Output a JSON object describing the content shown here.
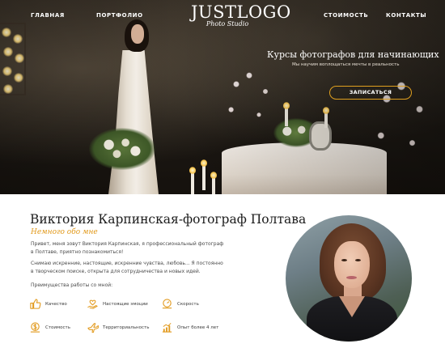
{
  "nav": {
    "home": "ГЛАВНАЯ",
    "portfolio": "ПОРТФОЛИО",
    "price": "СТОИМОСТЬ",
    "contacts": "КОНТАКТЫ"
  },
  "logo": {
    "main": "JUSTLOGO",
    "sub": "Photo Studio"
  },
  "hero": {
    "title": "Курсы фотографов для начинающих",
    "subtitle": "Мы научим воплощаться мечты в реальность",
    "button": "ЗАПИСАТЬСЯ"
  },
  "about": {
    "title": "Виктория Карпинская-фотограф Полтава",
    "script": "Немного обо мне",
    "p1": "Привет, меня зовут Виктория Карпинская, я профессиональный фотограф в Полтаве, приятно познакомиться!",
    "p2": "Снимаю искренние, настоящие, искренние чувства, любовь... Я постоянно в творческом поиске, открыта для сотрудничества и новых идей.",
    "p3": "Преимущества работы со мной:"
  },
  "features": [
    {
      "label": "Качество",
      "icon": "thumbs-up-icon"
    },
    {
      "label": "Настоящие эмоции",
      "icon": "heart-hand-icon"
    },
    {
      "label": "Скорость",
      "icon": "speed-icon"
    },
    {
      "label": "Стоимость",
      "icon": "price-icon"
    },
    {
      "label": "Территориальность",
      "icon": "plane-icon"
    },
    {
      "label": "Опыт более 4 лет",
      "icon": "experience-chart-icon"
    }
  ],
  "colors": {
    "accent": "#e29a1d",
    "hero_dark": "#1e1a15",
    "text": "#1c1c1c"
  }
}
